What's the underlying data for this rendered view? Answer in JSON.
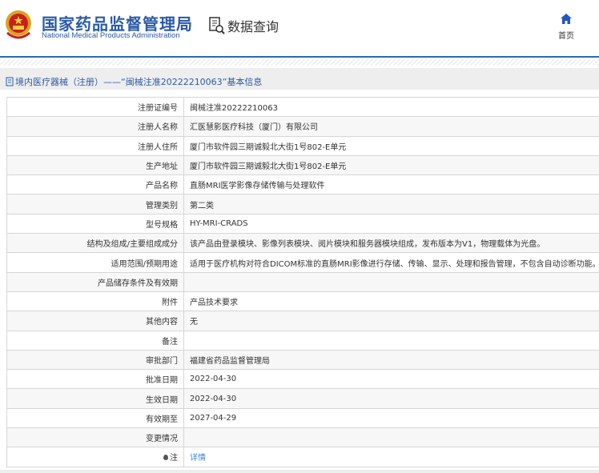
{
  "header": {
    "org_cn": "国家药品监督管理局",
    "org_en": "National Medical Products Administration",
    "data_query": "数据查询",
    "home": "首页"
  },
  "breadcrumb": "境内医疗器械（注册）——“闽械注准20222210063”基本信息",
  "rows": [
    {
      "label": "注册证编号",
      "value": "闽械注准20222210063"
    },
    {
      "label": "注册人名称",
      "value": "汇医慧影医疗科技（厦门）有限公司"
    },
    {
      "label": "注册人住所",
      "value": "厦门市软件园三期诚毅北大街1号802-E单元"
    },
    {
      "label": "生产地址",
      "value": "厦门市软件园三期诚毅北大街1号802-E单元"
    },
    {
      "label": "产品名称",
      "value": "直肠MRI医学影像存储传输与处理软件"
    },
    {
      "label": "管理类别",
      "value": "第二类"
    },
    {
      "label": "型号规格",
      "value": "HY-MRI-CRADS"
    },
    {
      "label": "结构及组成/主要组成成分",
      "value": "该产品由登录模块、影像列表模块、阅片模块和服务器模块组成，发布版本为V1，物理载体为光盘。"
    },
    {
      "label": "适用范围/预期用途",
      "value": "适用于医疗机构对符合DICOM标准的直肠MRI影像进行存储、传输、显示、处理和报告管理，不包含自动诊断功能。"
    },
    {
      "label": "产品储存条件及有效期",
      "value": ""
    },
    {
      "label": "附件",
      "value": "产品技术要求"
    },
    {
      "label": "其他内容",
      "value": "无"
    },
    {
      "label": "备注",
      "value": ""
    },
    {
      "label": "审批部门",
      "value": "福建省药品监督管理局"
    },
    {
      "label": "批准日期",
      "value": "2022-04-30"
    },
    {
      "label": "生效日期",
      "value": "2022-04-30"
    },
    {
      "label": "有效期至",
      "value": "2027-04-29"
    },
    {
      "label": "变更情况",
      "value": ""
    }
  ],
  "note": {
    "label": "注",
    "link": "详情"
  },
  "colors": {
    "brand": "#2a5aa8",
    "link": "#3a84d6"
  }
}
